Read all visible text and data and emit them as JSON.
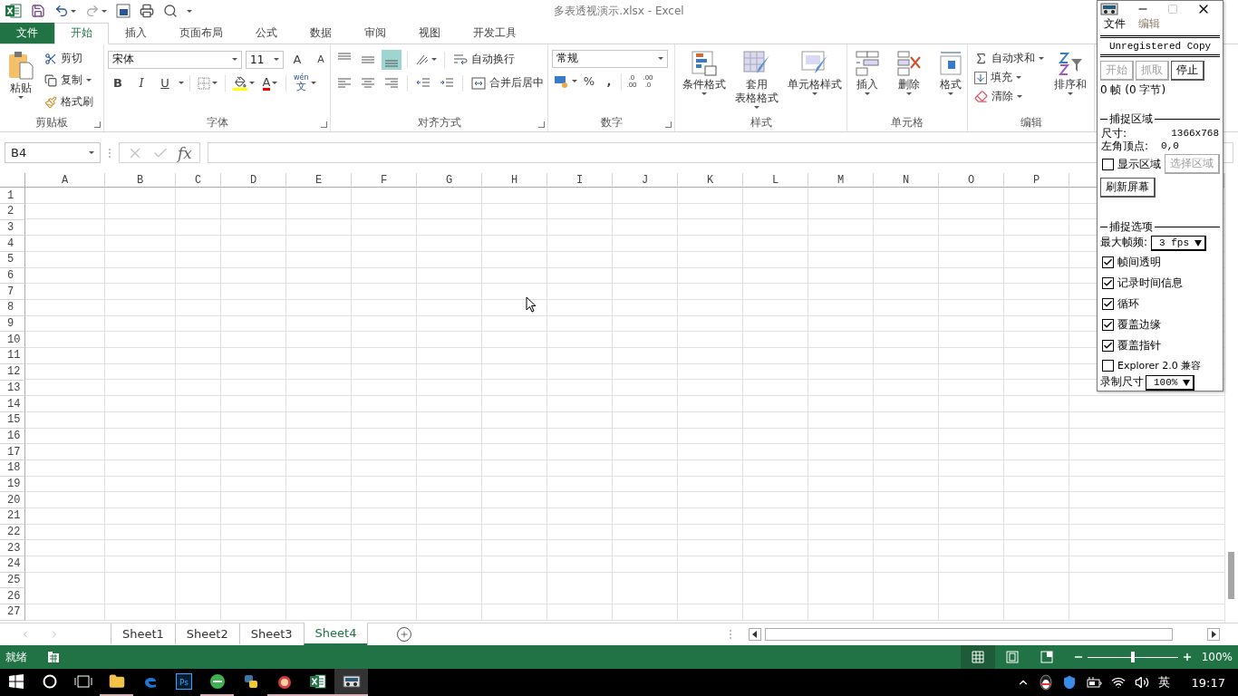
{
  "window": {
    "title": "多表透视演示.xlsx - Excel"
  },
  "ribbon_tabs": [
    {
      "label": "文件",
      "kind": "file",
      "selected": false
    },
    {
      "label": "开始",
      "kind": "tab",
      "selected": true
    },
    {
      "label": "插入",
      "kind": "tab",
      "selected": false
    },
    {
      "label": "页面布局",
      "kind": "tab",
      "selected": false
    },
    {
      "label": "公式",
      "kind": "tab",
      "selected": false
    },
    {
      "label": "数据",
      "kind": "tab",
      "selected": false
    },
    {
      "label": "审阅",
      "kind": "tab",
      "selected": false
    },
    {
      "label": "视图",
      "kind": "tab",
      "selected": false
    },
    {
      "label": "开发工具",
      "kind": "tab",
      "selected": false
    }
  ],
  "ribbon": {
    "clipboard": {
      "title": "剪贴板",
      "paste": "粘贴",
      "cut": "剪切",
      "copy": "复制",
      "format_painter": "格式刷"
    },
    "font": {
      "title": "字体",
      "name": "宋体",
      "size": "11",
      "grow": "A",
      "shrink": "A",
      "bold": "B",
      "italic": "I",
      "underline": "U",
      "font_color": "A",
      "phonetic": "wén",
      "phonetic_char": "文"
    },
    "alignment": {
      "title": "对齐方式",
      "vertical": [
        {
          "selected": false
        },
        {
          "selected": false
        },
        {
          "selected": true
        }
      ],
      "wrap": "自动换行",
      "merge": "合并后居中"
    },
    "number": {
      "title": "数字",
      "format": "常规",
      "percent": "%",
      "comma": ",",
      "decimals": [
        {
          "top": ".0",
          "bottom": ".00"
        },
        {
          "top": ".00",
          "bottom": ".0"
        }
      ]
    },
    "styles": {
      "title": "样式",
      "conditional": [
        "条件格式"
      ],
      "table": [
        "套用",
        "表格格式"
      ],
      "cell": [
        "单元格样式"
      ]
    },
    "cells": {
      "title": "单元格",
      "insert": "插入",
      "delete": "删除",
      "format": "格式"
    },
    "editing": {
      "title": "编辑",
      "autosum": "自动求和",
      "fill": "填充",
      "clear": "清除",
      "sort": "排序和"
    }
  },
  "formula_bar": {
    "name_box": "B4",
    "fx": "fx"
  },
  "grid": {
    "columns": [
      "A",
      "B",
      "C",
      "D",
      "E",
      "F",
      "G",
      "H",
      "I",
      "J",
      "K",
      "L",
      "M",
      "N",
      "O",
      "P"
    ],
    "rows": [
      "1",
      "2",
      "3",
      "4",
      "5",
      "6",
      "7",
      "8",
      "9",
      "10",
      "11",
      "12",
      "13",
      "14",
      "15",
      "16",
      "17",
      "18",
      "19",
      "20",
      "21",
      "22",
      "23",
      "24",
      "25",
      "26",
      "27"
    ]
  },
  "sheet_tabs": [
    {
      "label": "Sheet1",
      "selected": false
    },
    {
      "label": "Sheet2",
      "selected": false
    },
    {
      "label": "Sheet3",
      "selected": false
    },
    {
      "label": "Sheet4",
      "selected": true
    }
  ],
  "status_bar": {
    "status": "就绪",
    "views": [
      {
        "selected": true
      },
      {
        "selected": false
      },
      {
        "selected": false
      }
    ],
    "zoom_slider": {
      "level": 0.5
    },
    "zoom": "100%"
  },
  "taskbar": {
    "apps": [
      {
        "kind": "explorer",
        "running": true
      },
      {
        "kind": "edge",
        "running": false
      },
      {
        "kind": "photoshop",
        "label": "Ps",
        "running": false
      },
      {
        "kind": "browser",
        "running": true
      },
      {
        "kind": "python",
        "running": false
      },
      {
        "kind": "game",
        "running": true
      },
      {
        "kind": "excel",
        "running": true
      },
      {
        "kind": "recorder",
        "running": true,
        "selected": true
      }
    ],
    "ime": "英",
    "time": "19:17"
  },
  "recorder": {
    "menu": [
      {
        "label": "文件",
        "disabled": false
      },
      {
        "label": "编辑",
        "disabled": true
      }
    ],
    "banner": "Unregistered Copy",
    "buttons": [
      {
        "label": "开始",
        "disabled": true
      },
      {
        "label": "抓取",
        "disabled": true
      },
      {
        "label": "停止",
        "disabled": false
      }
    ],
    "frames": "0 帧 (0 字节)",
    "capture_area": {
      "title": "捕捉区域",
      "size_label": "尺寸:",
      "size": "1366x768",
      "corner_label": "左角顶点:",
      "corner": "0,0",
      "show_area": {
        "label": "显示区域",
        "checked": false
      },
      "select_area": {
        "label": "选择区域",
        "disabled": true
      },
      "refresh": "刷新屏幕"
    },
    "options": {
      "title": "捕捉选项",
      "fps_label": "最大帧频:",
      "fps": "3 fps",
      "checks": [
        {
          "label": "帧间透明",
          "checked": true
        },
        {
          "label": "记录时间信息",
          "checked": true
        },
        {
          "label": "循环",
          "checked": true
        },
        {
          "label": "覆盖边缘",
          "checked": true
        },
        {
          "label": "覆盖指针",
          "checked": true
        },
        {
          "label": "Explorer 2.0 兼容",
          "checked": false
        }
      ],
      "size_label": "录制尺寸",
      "size": "100%"
    }
  }
}
